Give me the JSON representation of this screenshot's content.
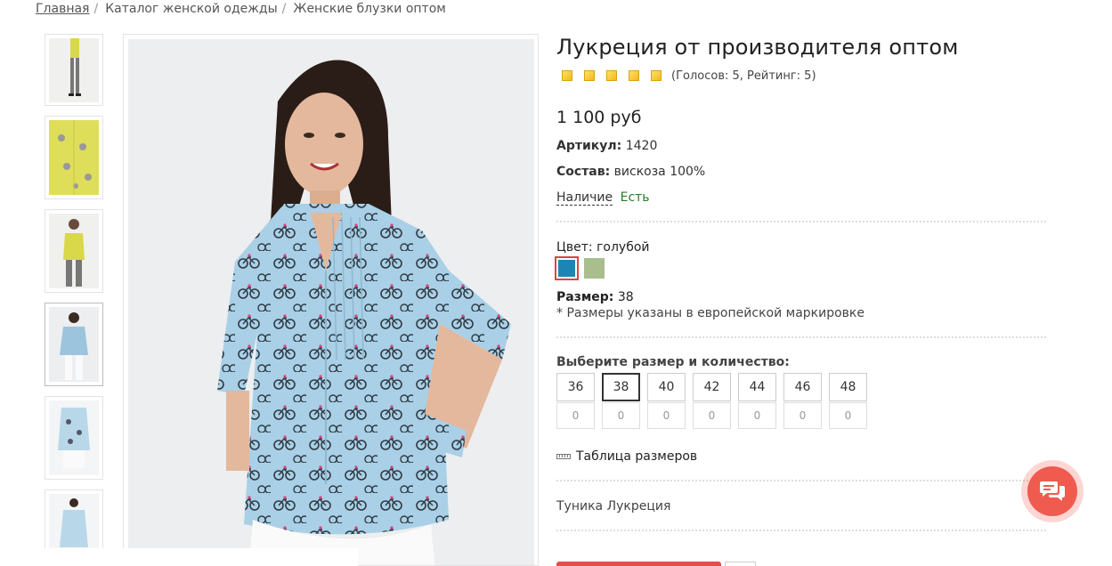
{
  "breadcrumb": {
    "home": "Главная",
    "catalog": "Каталог женской одежды",
    "current": "Женские блузки оптом",
    "separator": "/"
  },
  "product": {
    "title": "Лукреция от производителя оптом",
    "rating": {
      "stars": 5,
      "max": 5,
      "text": "(Голосов: 5, Рейтинг: 5)"
    },
    "price": "1 100 руб",
    "article_label": "Артикул:",
    "article_value": "1420",
    "composition_label": "Состав:",
    "composition_value": "вискоза 100%",
    "availability_label": "Наличие",
    "availability_value": "Есть",
    "color_label": "Цвет:",
    "color_value": "голубой",
    "colors": [
      {
        "name": "голубой",
        "hex": "#1b86b3",
        "selected": true
      },
      {
        "name": "оливковый",
        "hex": "#a9be8c",
        "selected": false
      }
    ],
    "size_label": "Размер:",
    "size_value": "38",
    "size_note": "* Размеры указаны в европейской маркировке",
    "choose_label": "Выберите размер и количество:",
    "sizes": [
      {
        "size": "36",
        "qty": "0"
      },
      {
        "size": "38",
        "qty": "0",
        "selected": true
      },
      {
        "size": "40",
        "qty": "0"
      },
      {
        "size": "42",
        "qty": "0"
      },
      {
        "size": "44",
        "qty": "0"
      },
      {
        "size": "46",
        "qty": "0"
      },
      {
        "size": "48",
        "qty": "0"
      }
    ],
    "size_table_link": "Таблица размеров",
    "description": "Туника Лукреция"
  },
  "colors": {
    "accent": "#ef5b4f",
    "available": "#2a7a2a",
    "star": "#f3b81a"
  },
  "icons": {
    "chat": "chat-bubbles-icon",
    "ruler": "ruler-icon",
    "star": "star-icon"
  }
}
